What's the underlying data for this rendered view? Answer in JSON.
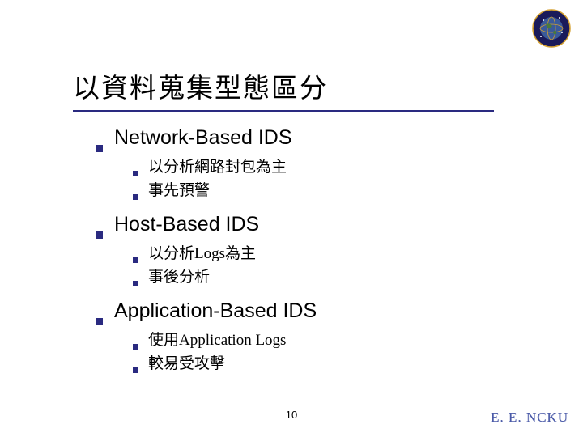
{
  "title": "以資料蒐集型態區分",
  "sections": [
    {
      "heading": "Network-Based IDS",
      "items": [
        "以分析網路封包為主",
        "事先預警"
      ]
    },
    {
      "heading": "Host-Based IDS",
      "items": [
        "以分析Logs為主",
        "事後分析"
      ]
    },
    {
      "heading": "Application-Based IDS",
      "items": [
        "使用Application Logs",
        "較易受攻擊"
      ]
    }
  ],
  "page_number": "10",
  "footer_text": "E. E. NCKU"
}
